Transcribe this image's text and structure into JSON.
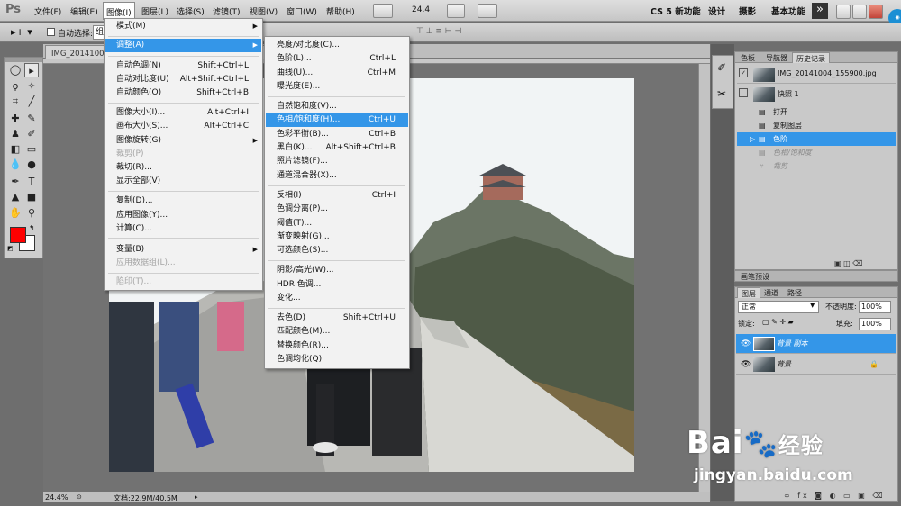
{
  "menubar": {
    "logo": "Ps",
    "items": [
      "文件(F)",
      "编辑(E)",
      "图像(I)",
      "图层(L)",
      "选择(S)",
      "滤镜(T)",
      "视图(V)",
      "窗口(W)",
      "帮助(H)"
    ],
    "zoom": "24.4",
    "workspaces": [
      "CS 5 新功能",
      "设计",
      "摄影",
      "基本功能"
    ],
    "overflow": "»",
    "cs_live": "CS Live"
  },
  "options": {
    "auto_select_label": "自动选择:",
    "auto_select_value": "组"
  },
  "document": {
    "tab": "IMG_20141004_155900.jpg @ 24.4% (背景 副本, RGB/8)",
    "zoom_status": "24.4%",
    "doc_status": "文档:22.9M/40.5M"
  },
  "image_menu": [
    {
      "label": "模式(M)",
      "arrow": true
    },
    {
      "label": "调整(A)",
      "arrow": true,
      "hl": true
    },
    {
      "label": "自动色调(N)",
      "sc": "Shift+Ctrl+L"
    },
    {
      "label": "自动对比度(U)",
      "sc": "Alt+Shift+Ctrl+L"
    },
    {
      "label": "自动颜色(O)",
      "sc": "Shift+Ctrl+B"
    },
    {
      "label": "图像大小(I)...",
      "sc": "Alt+Ctrl+I"
    },
    {
      "label": "画布大小(S)...",
      "sc": "Alt+Ctrl+C"
    },
    {
      "label": "图像旋转(G)",
      "arrow": true
    },
    {
      "label": "裁剪(P)",
      "dis": true
    },
    {
      "label": "裁切(R)..."
    },
    {
      "label": "显示全部(V)"
    },
    {
      "label": "复制(D)..."
    },
    {
      "label": "应用图像(Y)..."
    },
    {
      "label": "计算(C)..."
    },
    {
      "label": "变量(B)",
      "arrow": true
    },
    {
      "label": "应用数据组(L)...",
      "dis": true
    },
    {
      "label": "陷印(T)...",
      "dis": true
    }
  ],
  "adjust_menu": [
    {
      "label": "亮度/对比度(C)..."
    },
    {
      "label": "色阶(L)...",
      "sc": "Ctrl+L"
    },
    {
      "label": "曲线(U)...",
      "sc": "Ctrl+M"
    },
    {
      "label": "曝光度(E)..."
    },
    {
      "label": "自然饱和度(V)..."
    },
    {
      "label": "色相/饱和度(H)...",
      "sc": "Ctrl+U",
      "hl": true
    },
    {
      "label": "色彩平衡(B)...",
      "sc": "Ctrl+B"
    },
    {
      "label": "黑白(K)...",
      "sc": "Alt+Shift+Ctrl+B"
    },
    {
      "label": "照片滤镜(F)..."
    },
    {
      "label": "通道混合器(X)..."
    },
    {
      "label": "反相(I)",
      "sc": "Ctrl+I"
    },
    {
      "label": "色调分离(P)..."
    },
    {
      "label": "阈值(T)..."
    },
    {
      "label": "渐变映射(G)..."
    },
    {
      "label": "可选颜色(S)..."
    },
    {
      "label": "阴影/高光(W)..."
    },
    {
      "label": "HDR 色调..."
    },
    {
      "label": "变化..."
    },
    {
      "label": "去色(D)",
      "sc": "Shift+Ctrl+U"
    },
    {
      "label": "匹配颜色(M)..."
    },
    {
      "label": "替换颜色(R)..."
    },
    {
      "label": "色调均化(Q)"
    }
  ],
  "history_panel": {
    "tabs": [
      "色板",
      "导航器",
      "历史记录"
    ],
    "snapshot_file": "IMG_20141004_155900.jpg",
    "snapshot": "快照 1",
    "steps": [
      "打开",
      "复制图层",
      "色阶",
      "色相/饱和度",
      "裁剪"
    ]
  },
  "brush_panel": {
    "tab": "画笔预设"
  },
  "layers_panel": {
    "tabs": [
      "图层",
      "通道",
      "路径"
    ],
    "blend_mode": "正常",
    "opacity_label": "不透明度:",
    "opacity": "100%",
    "lock_label": "锁定:",
    "fill_label": "填充:",
    "fill": "100%",
    "layers": [
      "背景 副本",
      "背景"
    ]
  },
  "watermark": {
    "brand": "Bai",
    "brand2": "经验",
    "url": "jingyan.baidu.com"
  },
  "colors": {
    "foreground": "#ff0000",
    "background": "#ffffff",
    "highlight": "#3496e8"
  }
}
